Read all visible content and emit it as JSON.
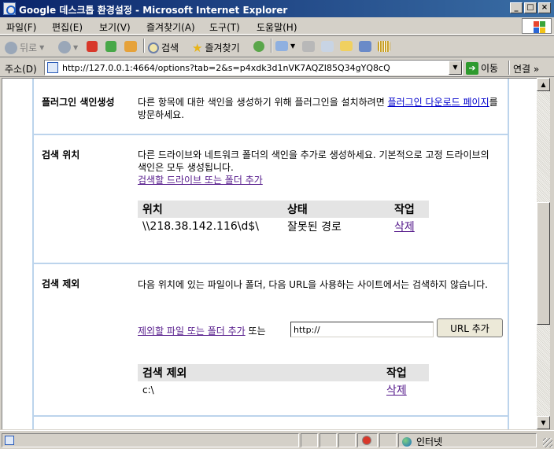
{
  "window": {
    "title": "Google 데스크톱 환경설정 - Microsoft Internet Explorer",
    "minimize": "_",
    "maximize": "□",
    "close": "×"
  },
  "menu": {
    "items": [
      "파일(F)",
      "편집(E)",
      "보기(V)",
      "즐겨찾기(A)",
      "도구(T)",
      "도움말(H)"
    ]
  },
  "toolbar": {
    "back_label": "뒤로",
    "search_label": "검색",
    "favorites_label": "즐겨찾기"
  },
  "address": {
    "label": "주소(D)",
    "url": "http://127.0.0.1:4664/options?tab=2&s=p4xdk3d1nVK7AQZI85Q34gYQ8cQ",
    "go_label": "이동",
    "links_label": "연결 »"
  },
  "sections": {
    "plugin": {
      "label": "플러그인 색인생성",
      "text_before": "다른 항목에 대한 색인을 생성하기 위해 플러그인을 설치하려면 ",
      "link": "플러그인 다운로드 페이지",
      "text_after": "를 방문하세요."
    },
    "search_location": {
      "label": "검색 위치",
      "text": "다른 드라이브와 네트워크 폴더의 색인을 추가로 생성하세요. 기본적으로 고정 드라이브의 색인은 모두 생성됩니다.",
      "add_link": "검색할 드라이브 또는 폴더 추가",
      "table": {
        "headers": [
          "위치",
          "상태",
          "작업"
        ],
        "rows": [
          {
            "location": "\\\\218.38.142.116\\d$\\",
            "status": "잘못된 경로",
            "action": "삭제"
          }
        ]
      }
    },
    "exclude": {
      "label": "검색 제외",
      "text": "다음 위치에 있는 파일이나 폴더, 다음 URL을 사용하는 사이트에서는 검색하지 않습니다.",
      "add_link": "제외할 파일 또는 폴더 추가",
      "or_text": "또는",
      "url_value": "http://",
      "url_button": "URL 추가",
      "table": {
        "headers": [
          "검색 제외",
          "작업"
        ],
        "rows": [
          {
            "item": "c:\\",
            "action": "삭제"
          }
        ]
      }
    }
  },
  "status": {
    "zone": "인터넷"
  },
  "colors": {
    "title_start": "#0a246a",
    "title_end": "#3a6ea5",
    "panel_border": "#bcd4ec",
    "link": "#0000cc",
    "visited_link": "#551a8b",
    "table_header": "#e4e4e4"
  }
}
